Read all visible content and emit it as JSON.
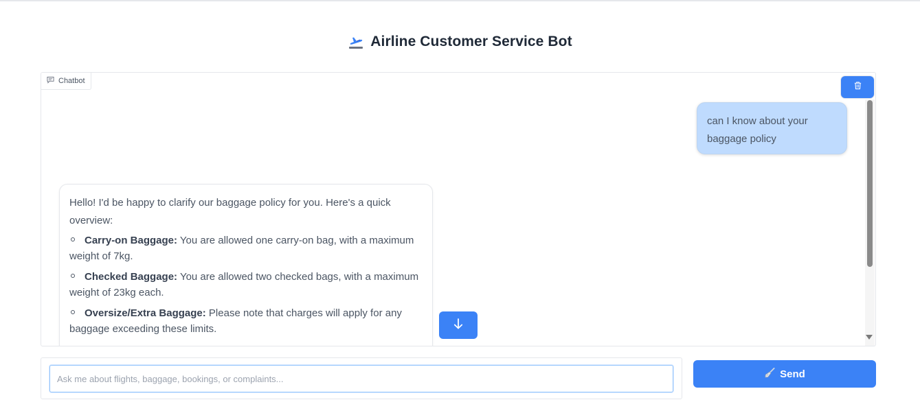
{
  "app": {
    "title": "Airline Customer Service Bot",
    "title_icon": "airplane-departure-icon"
  },
  "chatbot": {
    "label": "Chatbot",
    "label_icon": "chat-icon",
    "clear_icon": "trash-icon",
    "scroll_down_icon": "arrow-down-icon"
  },
  "messages": {
    "user": "can I know about your baggage policy",
    "bot": {
      "intro": "Hello! I'd be happy to clarify our baggage policy for you. Here's a quick overview:",
      "items": [
        {
          "title": "Carry-on Baggage:",
          "text": " You are allowed one carry-on bag, with a maximum weight of 7kg."
        },
        {
          "title": "Checked Baggage:",
          "text": " You are allowed two checked bags, with a maximum weight of 23kg each."
        },
        {
          "title": "Oversize/Extra Baggage:",
          "text": " Please note that charges will apply for any baggage exceeding these limits."
        }
      ]
    }
  },
  "input": {
    "placeholder": "Ask me about flights, baggage, bookings, or complaints...",
    "value": ""
  },
  "send": {
    "label": "Send",
    "icon": "broom-icon"
  },
  "colors": {
    "accent": "#3b82f6",
    "user_bubble": "#bfdbfe"
  }
}
